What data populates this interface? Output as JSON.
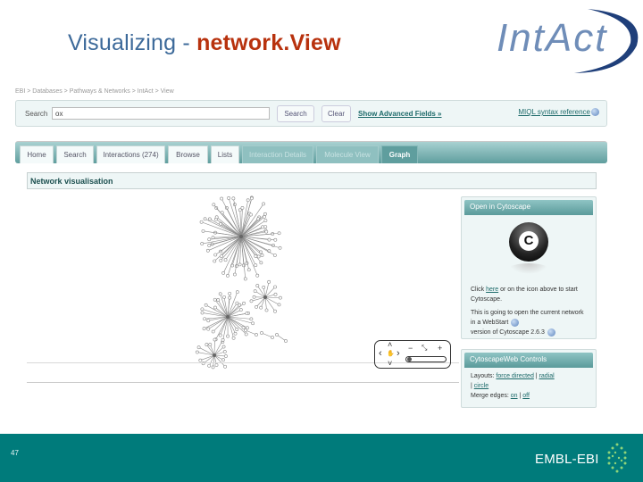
{
  "slide": {
    "title_part1": "Visualizing - ",
    "title_part2": "network.View",
    "logo_text": "IntAct",
    "page_number": "47",
    "footer_brand": "EMBL-EBI"
  },
  "colors": {
    "title_blue": "#3d6a9a",
    "title_red": "#b8320e",
    "teal": "#007b7b",
    "tab_teal": "#5f9e9e"
  },
  "breadcrumb": "EBI > Databases > Pathways & Networks > IntAct > View",
  "search": {
    "label": "Search",
    "value": "ox",
    "search_button": "Search",
    "clear_button": "Clear",
    "advanced_link": "Show Advanced Fields »",
    "miql_link": "MIQL syntax reference"
  },
  "tabs": [
    {
      "label": "Home",
      "state": "light"
    },
    {
      "label": "Search",
      "state": "light"
    },
    {
      "label": "Interactions (274)",
      "state": "light"
    },
    {
      "label": "Browse",
      "state": "light"
    },
    {
      "label": "Lists",
      "state": "light"
    },
    {
      "label": "Interaction Details",
      "state": "dim"
    },
    {
      "label": "Molecule View",
      "state": "dim"
    },
    {
      "label": "Graph",
      "state": "active"
    }
  ],
  "section": {
    "title": "Network visualisation"
  },
  "nav_control": {
    "up": "˄",
    "down": "˅",
    "left": "‹",
    "right": "›",
    "minus": "−",
    "plus": "+",
    "fit": "⤡"
  },
  "panel_cytoscape": {
    "title": "Open in Cytoscape",
    "icon_letter": "C",
    "text1_a": "Click ",
    "text1_link": "here",
    "text1_b": " or on the icon above to start Cytoscape.",
    "text2": "This is going to open the current network in a WebStart",
    "text3": "version of Cytoscape 2.6.3"
  },
  "panel_controls": {
    "title": "CytoscapeWeb Controls",
    "layouts_label": "Layouts:",
    "layout_force": "force directed",
    "layout_radial": "radial",
    "layout_circle": "circle",
    "merge_label": "Merge edges:",
    "merge_on": "on",
    "merge_off": "off"
  }
}
